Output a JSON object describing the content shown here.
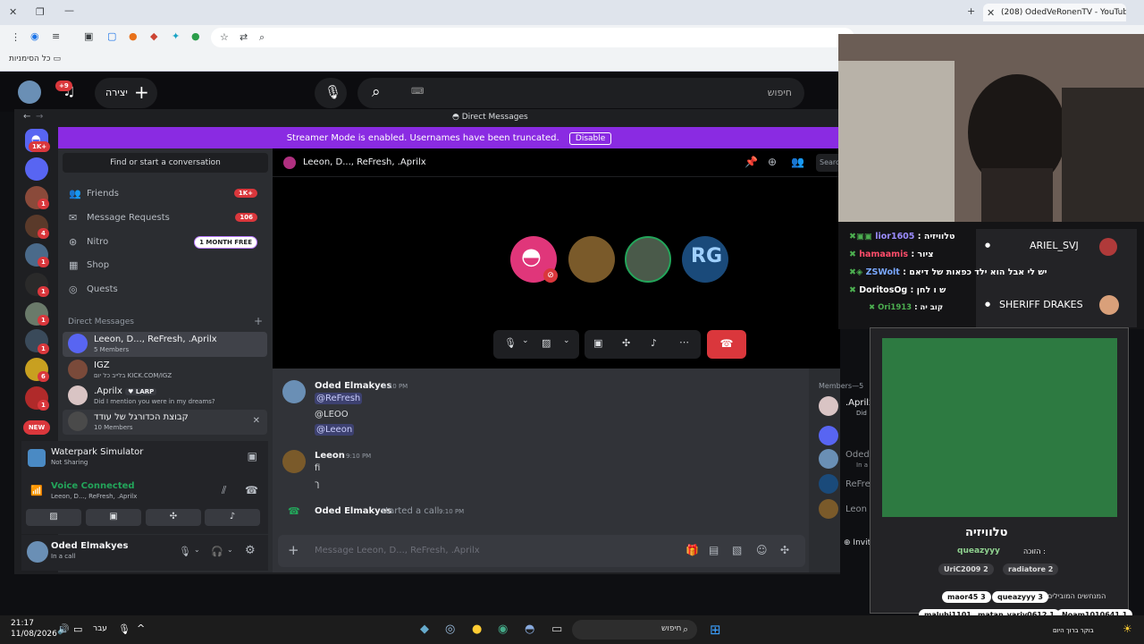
{
  "browser": {
    "tab_title": "(208) OdedVeRonenTV - YouTube",
    "bookmarks_all": "כל הסימניות"
  },
  "topbar": {
    "notifications_badge": "+9",
    "create_label": "יצירה",
    "search_placeholder": "חיפוש"
  },
  "app": {
    "title": "Direct Messages",
    "streamer_notice": "Streamer Mode is enabled. Usernames have been truncated.",
    "streamer_disable": "Disable"
  },
  "rail": {
    "home_badge": "1K+",
    "servers": [
      {
        "badge": "1"
      },
      {
        "badge": "1"
      },
      {
        "badge": "4"
      },
      {
        "badge": "1"
      },
      {
        "badge": "1"
      },
      {
        "badge": "1"
      },
      {
        "badge": "1"
      },
      {
        "badge": "6"
      },
      {
        "badge": "1"
      }
    ],
    "new_label": "NEW"
  },
  "sidebar": {
    "find_placeholder": "Find or start a conversation",
    "nav": [
      {
        "label": "Friends",
        "badge": "1K+",
        "icon": "friends-icon"
      },
      {
        "label": "Message Requests",
        "badge": "106",
        "icon": "mail-icon"
      },
      {
        "label": "Nitro",
        "badge": "1 MONTH FREE",
        "icon": "nitro-icon"
      },
      {
        "label": "Shop",
        "badge": "",
        "icon": "shop-icon"
      },
      {
        "label": "Quests",
        "badge": "",
        "icon": "quests-icon"
      }
    ],
    "dm_header": "Direct Messages",
    "dms": [
      {
        "name": "Leeon, D..., ReFresh, .Aprilx",
        "sub": "5 Members"
      },
      {
        "name": "IGZ",
        "sub": "בלייב כל יום KICK.COM/IGZ"
      },
      {
        "name": ".Aprilx",
        "tag": "LARP",
        "sub": "Did I mention you were in my dreams?"
      },
      {
        "name": "קבוצת הכדורגל של עודד",
        "sub": "10 Members"
      }
    ]
  },
  "activity": {
    "title": "Waterpark Simulator",
    "sub": "Not Sharing"
  },
  "voice": {
    "status": "Voice Connected",
    "channel": "Leeon, D..., ReFresh, .Aprilx"
  },
  "user": {
    "name": "Oded Elmakyes",
    "status": "In a call"
  },
  "channel": {
    "title": "Leeon, D..., ReFresh, .Aprilx",
    "search": "Search"
  },
  "messages": [
    {
      "author": "Oded Elmakyes",
      "time": "9:10 PM",
      "lines": [
        "@ReFresh",
        "@LEOO",
        "@Leeon"
      ]
    },
    {
      "author": "Leeon",
      "time": "9:10 PM",
      "lines": [
        "fi",
        "ך"
      ]
    },
    {
      "system_author": "Oded Elmakyes",
      "system_text": "started a call.",
      "time": "9:10 PM"
    }
  ],
  "composer": {
    "placeholder": "Message Leeon, D..., ReFresh, .Aprilx"
  },
  "members": {
    "header": "Members—5",
    "first": ".Aprilx",
    "first_sub": "Did",
    "second": "Oded",
    "second_sub": "In a c",
    "third": "ReFre",
    "fourth": "Leon",
    "invite": "Invite to Group DM"
  },
  "stream_chat": [
    {
      "user": "lior1605",
      "text": ": טלוויזיה",
      "color": "#9b8cff"
    },
    {
      "user": "hamaamis",
      "text": ": ציור",
      "color": "#ff4d6a"
    },
    {
      "user": "ZSWolt",
      "text": ": יש לי אבל הוא ילד כפאות של דיאם",
      "color": "#7aa8ff"
    },
    {
      "user": "DoritosOg",
      "text": ": ש ו לחן",
      "color": "#ffffff"
    },
    {
      "user": "Ori1913",
      "text": ": קוב יה",
      "color": "#4caf50"
    }
  ],
  "players": [
    {
      "name": "ARIEL_SVJ"
    },
    {
      "name": "SHERIFF DRAKES"
    }
  ],
  "widget": {
    "title": "טלוויזיה",
    "winner_label": "הזוכה :",
    "winner": "queazyyy",
    "chips_top": [
      {
        "name": "UriC2009",
        "count": "2"
      },
      {
        "name": "radiatore",
        "count": "2"
      }
    ],
    "leaderboard_title": "המנחשים המובילים",
    "leaderboard": [
      {
        "name": "maor45",
        "count": "3"
      },
      {
        "name": "queazyyy",
        "count": "3"
      },
      {
        "name": "maluhi1101",
        "count": "1"
      },
      {
        "name": "matan_yariv0612",
        "count": "1"
      },
      {
        "name": "Noam1010641",
        "count": "1"
      }
    ],
    "footer": "בוקר ברוך היום"
  },
  "taskbar": {
    "time": "21:17",
    "date": "11/08/2026",
    "lang": "עבר",
    "search": "חיפוש"
  },
  "colors": {
    "blurple": "#5865f2",
    "streamer_purple": "#8a2be2",
    "danger": "#da373c",
    "online": "#23a55a"
  }
}
